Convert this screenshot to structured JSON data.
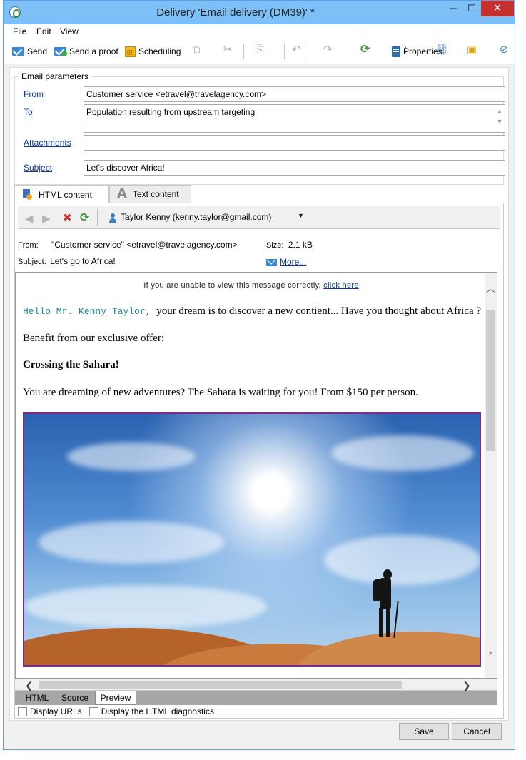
{
  "window": {
    "title": "Delivery 'Email delivery (DM39)' *",
    "controls": {
      "minimize": "─",
      "maximize": "☐",
      "close": "✕"
    }
  },
  "menu": [
    "File",
    "Edit",
    "View"
  ],
  "toolbar": {
    "send": "Send",
    "send_proof": "Send a proof",
    "scheduling": "Scheduling",
    "properties": "Properties"
  },
  "email_params": {
    "legend": "Email parameters",
    "from_label": "From",
    "from_value": "Customer service <etravel@travelagency.com>",
    "to_label": "To",
    "to_value": "Population resulting from upstream targeting",
    "attachments_label": "Attachments",
    "attachments_value": "",
    "subject_label": "Subject",
    "subject_value": "Let's discover Africa!"
  },
  "tabs": {
    "html": "HTML content",
    "text": "Text content"
  },
  "preview_toolbar": {
    "recipient": "Taylor Kenny (kenny.taylor@gmail.com)"
  },
  "meta": {
    "from_label": "From:",
    "from_value": "\"Customer service\" <etravel@travelagency.com>",
    "size_label": "Size:",
    "size_value": "2.1 kB",
    "subject_label": "Subject:",
    "subject_value": "Let's go to Africa!",
    "more": "More..."
  },
  "email_body": {
    "view_notice": "If you are unable to view this message correctly,",
    "view_link": "click here",
    "greeting": "Hello Mr. Kenny Taylor,",
    "line1": "your dream is to discover a new contient... Have you thought about Africa ?",
    "line2": "Benefit from our exclusive offer:",
    "heading": "Crossing the Sahara!",
    "line3": "You are dreaming of new adventures? The Sahara is waiting for you! From $150 per person."
  },
  "bottom_tabs": {
    "html": "HTML",
    "source": "Source",
    "preview": "Preview"
  },
  "options": {
    "display_urls": "Display URLs",
    "html_diag": "Display the HTML diagnostics"
  },
  "buttons": {
    "save": "Save",
    "cancel": "Cancel"
  },
  "colors": {
    "titlebar": "#7cc0f7",
    "close": "#c7312d",
    "link": "#0b37a4",
    "greeting": "#1b8a8a",
    "hero_border": "#7b2a8a"
  }
}
